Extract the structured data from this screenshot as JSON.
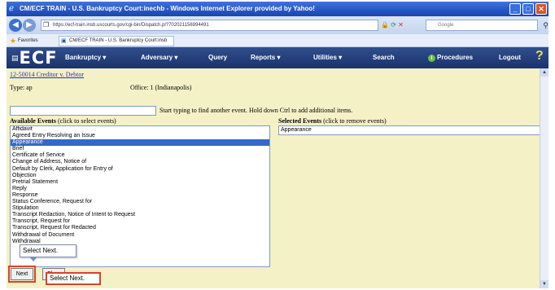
{
  "window": {
    "title": "CM/ECF TRAIN - U.S. Bankruptcy Court:inechb - Windows Internet Explorer provided by Yahoo!",
    "controls": [
      "minimize",
      "maximize",
      "close"
    ]
  },
  "browser": {
    "address": "https://ecf-train.insb.uscourts.gov/cgi-bin/Dispatch.pl?702021156994491",
    "search_placeholder": "Google",
    "favorites_label": "Favorites",
    "tab_title": "CM/ECF TRAIN - U.S. Bankruptcy Court:insb"
  },
  "ecf": {
    "logo": "ECF",
    "menu": [
      "Bankruptcy ▾",
      "Adversary ▾",
      "Query",
      "Reports ▾",
      "Utilities ▾",
      "Search",
      "Procedures",
      "Logout"
    ]
  },
  "case": {
    "link": "12-50014 Creditor v. Debtor",
    "type": "Type: ap",
    "office": "Office: 1 (Indianapolis)"
  },
  "find": {
    "value": "",
    "hint": "Start typing to find another event. Hold down Ctrl to add additional items."
  },
  "available": {
    "heading": "Available Events",
    "note": "(click to select events)",
    "items": [
      "Affidavit",
      "Agreed Entry Resolving an Issue",
      "Appearance",
      "Brief",
      "Certificate of Service",
      "Change of Address, Notice of",
      "Default by Clerk, Application for Entry of",
      "Objection",
      "Pretrial Statement",
      "Reply",
      "Response",
      "Status Conference, Request for",
      "Stipulation",
      "Transcript Redaction, Notice of Intent to Request",
      "Transcript, Request for",
      "Transcript, Request for Redacted",
      "Withdrawal of Document",
      "Withdrawal"
    ],
    "selected_index": 2
  },
  "selected": {
    "heading": "Selected Events",
    "note": "(click to remove events)",
    "items": [
      "Appearance"
    ]
  },
  "tooltip": "Select Next.",
  "buttons": {
    "next": "Next",
    "clear": "Clear"
  },
  "callout": "Select Next."
}
